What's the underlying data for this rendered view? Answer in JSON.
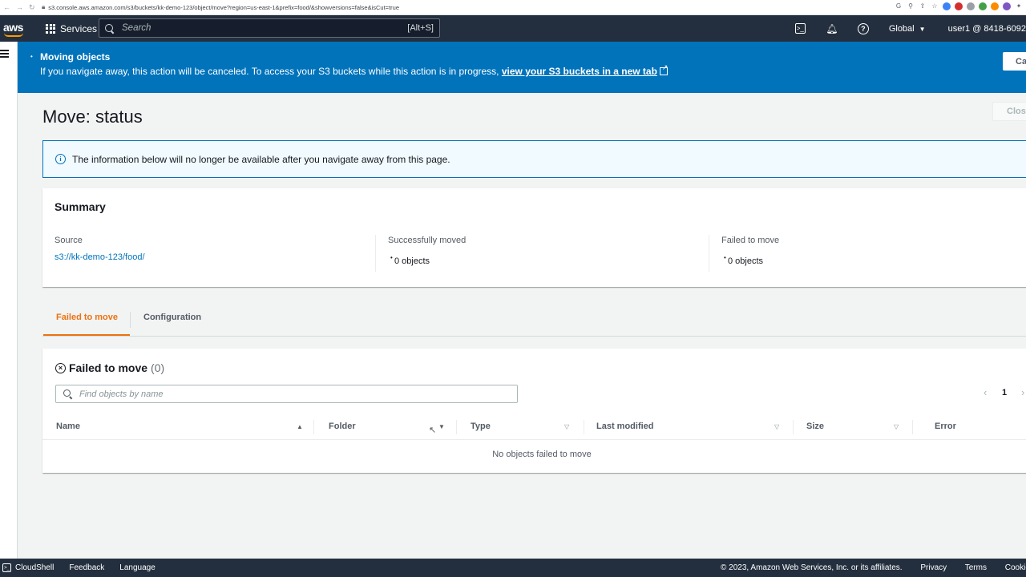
{
  "browser": {
    "url": "s3.console.aws.amazon.com/s3/buckets/kk-demo-123/object/move?region=us-east-1&prefix=food/&showversions=false&isCut=true"
  },
  "topnav": {
    "brand": "aws",
    "services_label": "Services",
    "search_placeholder": "Search",
    "search_shortcut": "[Alt+S]",
    "region_label": "Global",
    "account_label": "user1 @ 8418-6092"
  },
  "flash": {
    "title": "Moving objects",
    "message": "If you navigate away, this action will be canceled. To access your S3 buckets while this action is in progress, ",
    "link_text": "view your S3 buckets in a new tab",
    "cancel_label": "Ca"
  },
  "page": {
    "title": "Move: status",
    "close_label": "Clos"
  },
  "info_alert": {
    "text": "The information below will no longer be available after you navigate away from this page."
  },
  "summary": {
    "heading": "Summary",
    "source_label": "Source",
    "source_value": "s3://kk-demo-123/food/",
    "moved_label": "Successfully moved",
    "moved_value": "0 objects",
    "failed_label": "Failed to move",
    "failed_value": "0 objects"
  },
  "tabs": [
    {
      "label": "Failed to move",
      "active": true
    },
    {
      "label": "Configuration",
      "active": false
    }
  ],
  "failed_table": {
    "heading": "Failed to move",
    "count": "(0)",
    "search_placeholder": "Find objects by name",
    "page_number": "1",
    "columns": [
      "Name",
      "Folder",
      "Type",
      "Last modified",
      "Size",
      "Error"
    ],
    "empty_message": "No objects failed to move"
  },
  "footer": {
    "cloudshell": "CloudShell",
    "feedback": "Feedback",
    "language": "Language",
    "copyright": "© 2023, Amazon Web Services, Inc. or its affiliates.",
    "privacy": "Privacy",
    "terms": "Terms",
    "cookie": "Cookie pr"
  },
  "colors": {
    "nav_bg": "#232f3e",
    "flash_bg": "#0073bb",
    "accent": "#ec7211",
    "link": "#0073bb"
  },
  "icons": [
    "back-icon",
    "forward-icon",
    "reload-icon",
    "lock-icon",
    "grid-icon",
    "search-icon",
    "cloudshell-icon",
    "bell-icon",
    "help-icon",
    "caret-down-icon",
    "hamburger-icon",
    "spinner-icon",
    "external-link-icon",
    "info-icon",
    "x-circle-icon",
    "chevron-left-icon",
    "chevron-right-icon",
    "sort-icon"
  ]
}
